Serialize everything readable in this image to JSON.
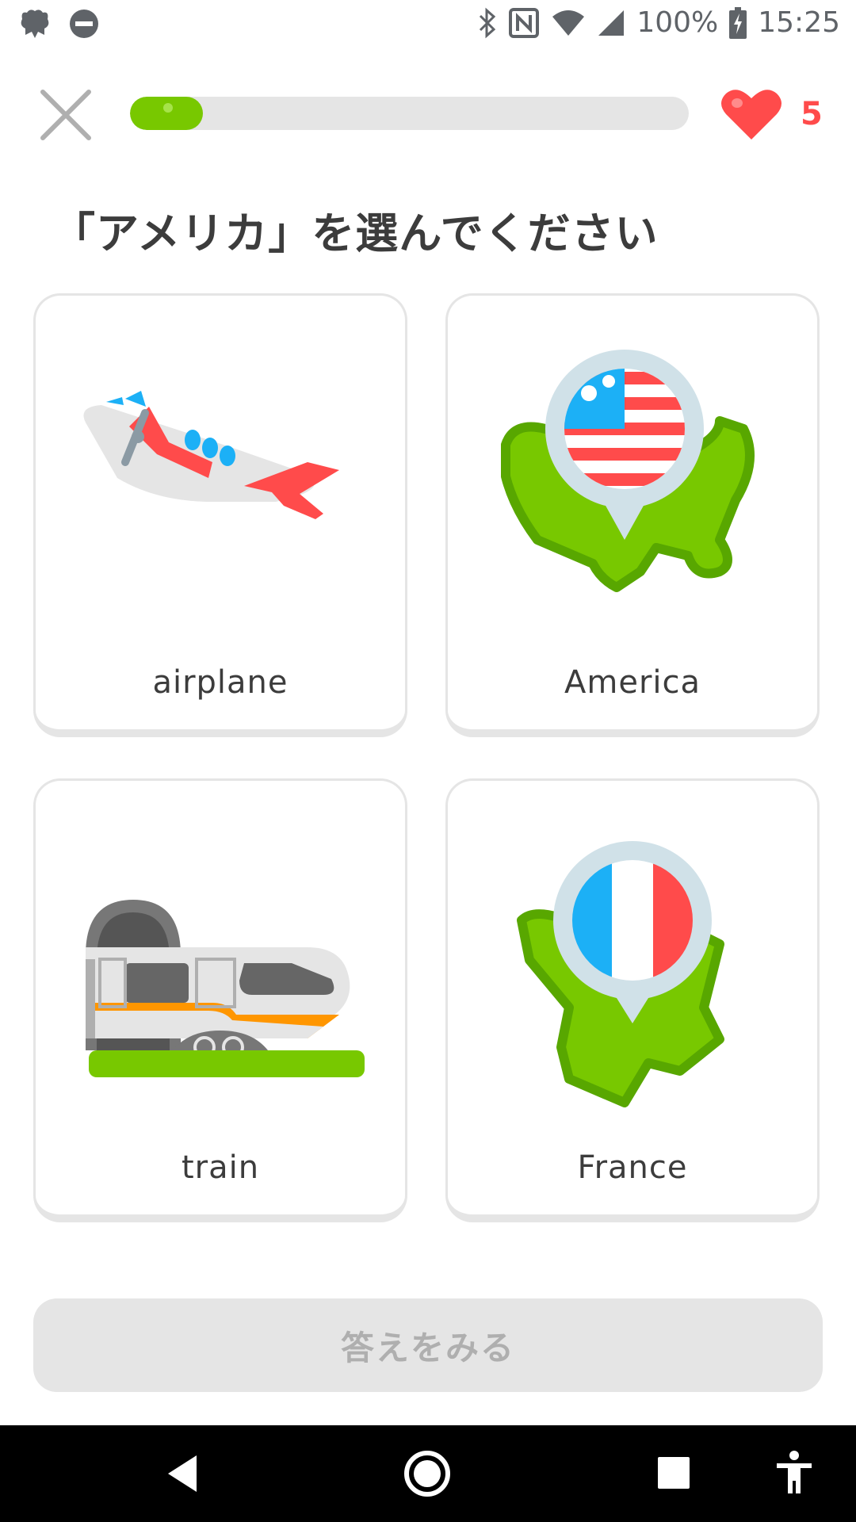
{
  "status_bar": {
    "battery_percent": "100%",
    "time": "15:25",
    "left_icons": [
      "duolingo-notification-icon",
      "do-not-disturb-icon"
    ],
    "right_icons": [
      "bluetooth-icon",
      "nfc-icon",
      "wifi-icon",
      "signal-icon",
      "battery-charging-icon"
    ]
  },
  "lesson": {
    "progress_fraction": 0.13,
    "hearts_count": "5",
    "prompt": "「アメリカ」を選んでください"
  },
  "choices": [
    {
      "label": "airplane",
      "icon": "airplane-illustration"
    },
    {
      "label": "America",
      "icon": "america-map-illustration"
    },
    {
      "label": "train",
      "icon": "train-illustration"
    },
    {
      "label": "France",
      "icon": "france-map-illustration"
    }
  ],
  "check_button": {
    "label": "答えをみる"
  },
  "colors": {
    "green": "#78c800",
    "red": "#ff4b4b",
    "gray": "#e5e5e5",
    "text": "#3c3c3c"
  }
}
